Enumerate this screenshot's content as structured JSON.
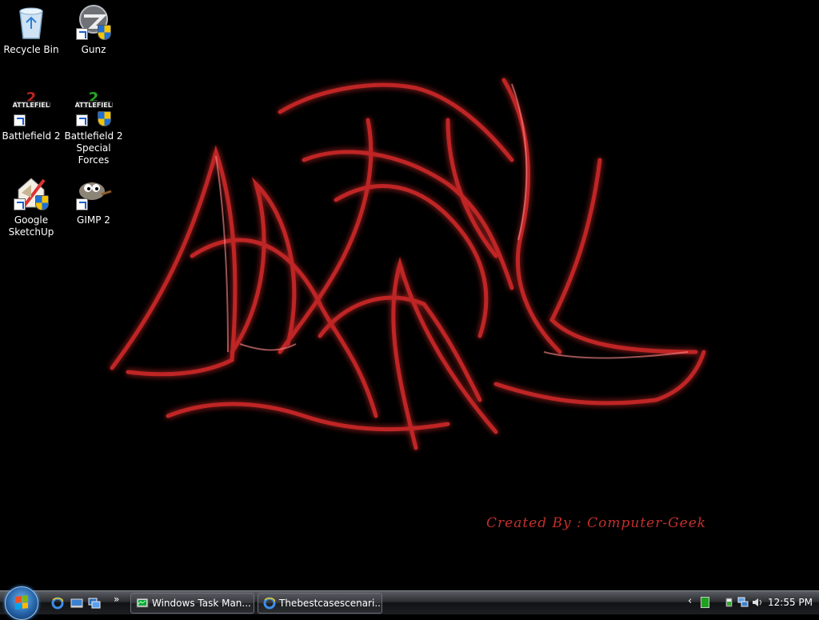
{
  "desktop": {
    "icons": [
      {
        "label": "Recycle Bin",
        "icon": "recycle-bin-icon"
      },
      {
        "label": "Gunz",
        "icon": "gunz-icon"
      },
      {
        "label": "Battlefield 2",
        "icon": "battlefield-icon"
      },
      {
        "label": "Battlefield 2 Special Forces",
        "icon": "battlefield-sf-icon"
      },
      {
        "label": "Google SketchUp",
        "icon": "sketchup-icon"
      },
      {
        "label": "GIMP 2",
        "icon": "gimp-icon"
      }
    ],
    "wallpaper": {
      "signature": "Created By : Computer-Geek",
      "accent_color": "#d42a2a"
    }
  },
  "taskbar": {
    "quick_launch": [
      {
        "icon": "internet-explorer-icon"
      },
      {
        "icon": "show-desktop-icon"
      },
      {
        "icon": "switch-windows-icon"
      }
    ],
    "quick_launch_more": "»",
    "tasks": [
      {
        "label": "Windows Task Man...",
        "icon": "task-manager-icon"
      },
      {
        "label": "Thebestcasescenari...",
        "icon": "internet-explorer-icon"
      }
    ],
    "tray": {
      "chevron": "‹",
      "clock": "12:55 PM"
    }
  }
}
